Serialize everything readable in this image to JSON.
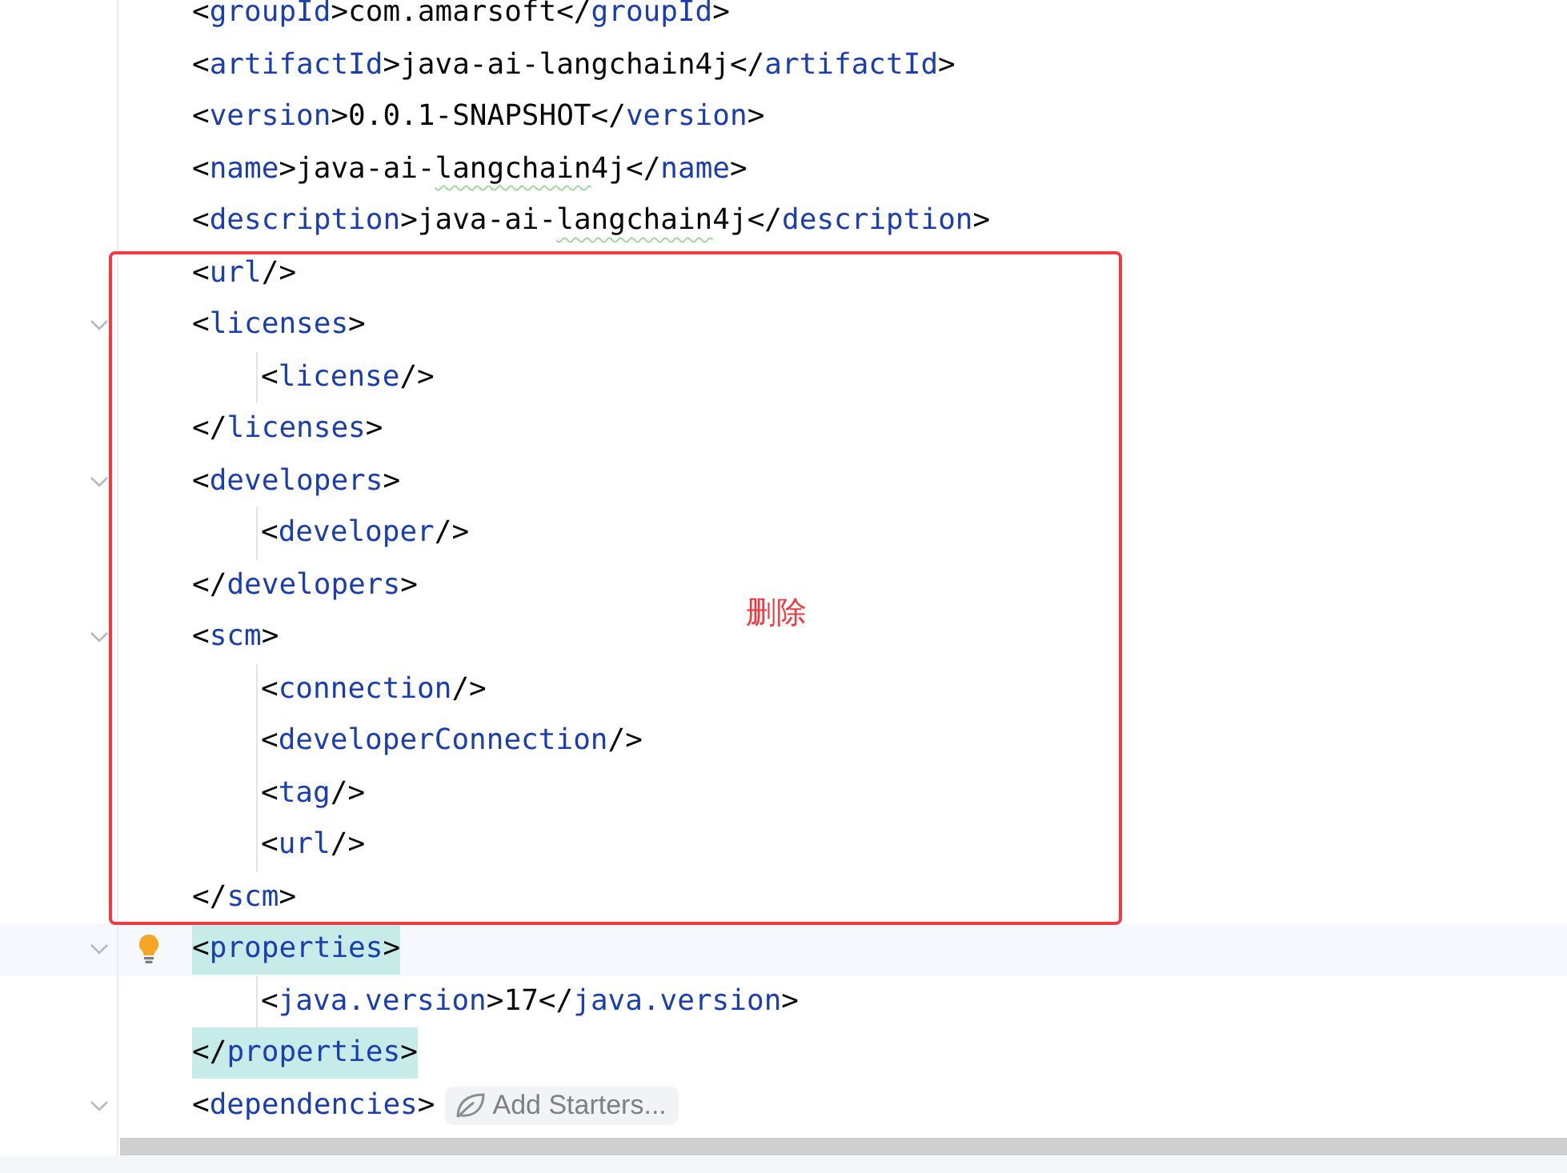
{
  "editor": {
    "lines": [
      {
        "segments": [
          {
            "kind": "bracket",
            "text": "<"
          },
          {
            "kind": "tag",
            "text": "groupId"
          },
          {
            "kind": "bracket",
            "text": ">"
          },
          {
            "kind": "text",
            "text": "com.amarsoft"
          },
          {
            "kind": "bracket",
            "text": "</"
          },
          {
            "kind": "tag",
            "text": "groupId"
          },
          {
            "kind": "bracket",
            "text": ">"
          }
        ]
      },
      {
        "segments": [
          {
            "kind": "bracket",
            "text": "<"
          },
          {
            "kind": "tag",
            "text": "artifactId"
          },
          {
            "kind": "bracket",
            "text": ">"
          },
          {
            "kind": "text",
            "text": "java-ai-langchain4j"
          },
          {
            "kind": "bracket",
            "text": "</"
          },
          {
            "kind": "tag",
            "text": "artifactId"
          },
          {
            "kind": "bracket",
            "text": ">"
          }
        ]
      },
      {
        "segments": [
          {
            "kind": "bracket",
            "text": "<"
          },
          {
            "kind": "tag",
            "text": "version"
          },
          {
            "kind": "bracket",
            "text": ">"
          },
          {
            "kind": "text",
            "text": "0.0.1-SNAPSHOT"
          },
          {
            "kind": "bracket",
            "text": "</"
          },
          {
            "kind": "tag",
            "text": "version"
          },
          {
            "kind": "bracket",
            "text": ">"
          }
        ]
      },
      {
        "segments": [
          {
            "kind": "bracket",
            "text": "<"
          },
          {
            "kind": "tag",
            "text": "name"
          },
          {
            "kind": "bracket",
            "text": ">"
          },
          {
            "kind": "text",
            "text": "java-ai-"
          },
          {
            "kind": "text",
            "text": "langchain",
            "typo": true
          },
          {
            "kind": "text",
            "text": "4j"
          },
          {
            "kind": "bracket",
            "text": "</"
          },
          {
            "kind": "tag",
            "text": "name"
          },
          {
            "kind": "bracket",
            "text": ">"
          }
        ]
      },
      {
        "segments": [
          {
            "kind": "bracket",
            "text": "<"
          },
          {
            "kind": "tag",
            "text": "description"
          },
          {
            "kind": "bracket",
            "text": ">"
          },
          {
            "kind": "text",
            "text": "java-ai-"
          },
          {
            "kind": "text",
            "text": "langchain",
            "typo": true
          },
          {
            "kind": "text",
            "text": "4j"
          },
          {
            "kind": "bracket",
            "text": "</"
          },
          {
            "kind": "tag",
            "text": "description"
          },
          {
            "kind": "bracket",
            "text": ">"
          }
        ]
      },
      {
        "segments": [
          {
            "kind": "bracket",
            "text": "<"
          },
          {
            "kind": "tag",
            "text": "url"
          },
          {
            "kind": "bracket",
            "text": "/>"
          }
        ]
      },
      {
        "fold": true,
        "segments": [
          {
            "kind": "bracket",
            "text": "<"
          },
          {
            "kind": "tag",
            "text": "licenses"
          },
          {
            "kind": "bracket",
            "text": ">"
          }
        ],
        "children": [
          {
            "segments": [
              {
                "kind": "bracket",
                "text": "<"
              },
              {
                "kind": "tag",
                "text": "license"
              },
              {
                "kind": "bracket",
                "text": "/>"
              }
            ]
          }
        ]
      },
      {
        "segments": [
          {
            "kind": "bracket",
            "text": "</"
          },
          {
            "kind": "tag",
            "text": "licenses"
          },
          {
            "kind": "bracket",
            "text": ">"
          }
        ]
      },
      {
        "fold": true,
        "segments": [
          {
            "kind": "bracket",
            "text": "<"
          },
          {
            "kind": "tag",
            "text": "developers"
          },
          {
            "kind": "bracket",
            "text": ">"
          }
        ],
        "children": [
          {
            "segments": [
              {
                "kind": "bracket",
                "text": "<"
              },
              {
                "kind": "tag",
                "text": "developer"
              },
              {
                "kind": "bracket",
                "text": "/>"
              }
            ]
          }
        ]
      },
      {
        "segments": [
          {
            "kind": "bracket",
            "text": "</"
          },
          {
            "kind": "tag",
            "text": "developers"
          },
          {
            "kind": "bracket",
            "text": ">"
          }
        ]
      },
      {
        "fold": true,
        "segments": [
          {
            "kind": "bracket",
            "text": "<"
          },
          {
            "kind": "tag",
            "text": "scm"
          },
          {
            "kind": "bracket",
            "text": ">"
          }
        ],
        "children": [
          {
            "segments": [
              {
                "kind": "bracket",
                "text": "<"
              },
              {
                "kind": "tag",
                "text": "connection"
              },
              {
                "kind": "bracket",
                "text": "/>"
              }
            ]
          },
          {
            "segments": [
              {
                "kind": "bracket",
                "text": "<"
              },
              {
                "kind": "tag",
                "text": "developerConnection"
              },
              {
                "kind": "bracket",
                "text": "/>"
              }
            ]
          },
          {
            "segments": [
              {
                "kind": "bracket",
                "text": "<"
              },
              {
                "kind": "tag",
                "text": "tag"
              },
              {
                "kind": "bracket",
                "text": "/>"
              }
            ]
          },
          {
            "segments": [
              {
                "kind": "bracket",
                "text": "<"
              },
              {
                "kind": "tag",
                "text": "url"
              },
              {
                "kind": "bracket",
                "text": "/>"
              }
            ]
          }
        ]
      },
      {
        "segments": [
          {
            "kind": "bracket",
            "text": "</"
          },
          {
            "kind": "tag",
            "text": "scm"
          },
          {
            "kind": "bracket",
            "text": ">"
          }
        ]
      },
      {
        "fold": true,
        "current": true,
        "brace_match": true,
        "bulb": true,
        "segments": [
          {
            "kind": "bracket",
            "text": "<"
          },
          {
            "kind": "tag",
            "text": "properties"
          },
          {
            "kind": "bracket",
            "text": ">"
          }
        ],
        "children": [
          {
            "segments": [
              {
                "kind": "bracket",
                "text": "<"
              },
              {
                "kind": "tag",
                "text": "java.version"
              },
              {
                "kind": "bracket",
                "text": ">"
              },
              {
                "kind": "text",
                "text": "17"
              },
              {
                "kind": "bracket",
                "text": "</"
              },
              {
                "kind": "tag",
                "text": "java.version"
              },
              {
                "kind": "bracket",
                "text": ">"
              }
            ]
          }
        ]
      },
      {
        "brace_match": true,
        "segments": [
          {
            "kind": "bracket",
            "text": "</"
          },
          {
            "kind": "tag",
            "text": "properties"
          },
          {
            "kind": "bracket",
            "text": ">"
          }
        ]
      },
      {
        "fold": true,
        "segments": [
          {
            "kind": "bracket",
            "text": "<"
          },
          {
            "kind": "tag",
            "text": "dependencies"
          },
          {
            "kind": "bracket",
            "text": ">"
          }
        ],
        "inlay": {
          "label": "Add Starters..."
        }
      }
    ]
  },
  "annotation": {
    "label": "删除"
  }
}
